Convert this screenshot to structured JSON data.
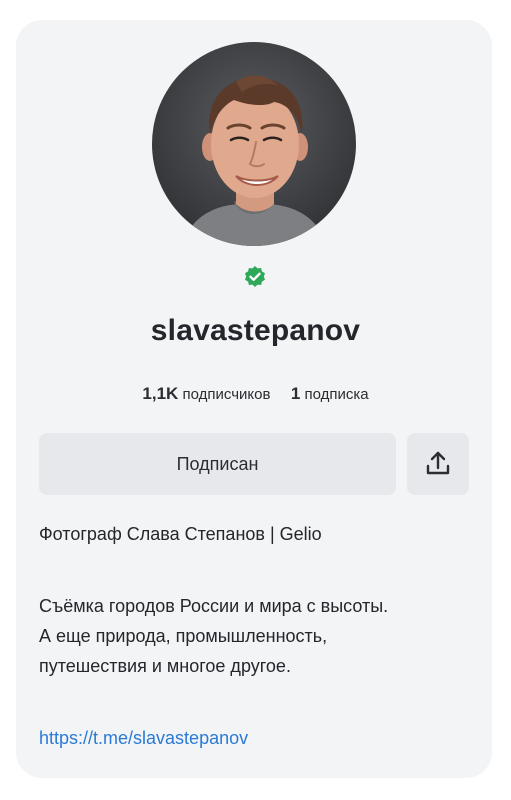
{
  "profile": {
    "username": "slavastepanov",
    "verified_icon": "verified-badge-icon",
    "stats": {
      "followers_count": "1,1K",
      "followers_label": "подписчиков",
      "following_count": "1",
      "following_label": "подписка"
    },
    "subscribe_label": "Подписан",
    "share_icon": "share-upload-icon",
    "bio_title": "Фотограф Слава Степанов | Gelio",
    "bio_lines": [
      "Съёмка городов России и мира с высоты.",
      "А еще природа, промышленность,",
      "путешествия и многое другое."
    ],
    "link": "https://t.me/slavastepanov"
  },
  "colors": {
    "card_bg": "#f3f4f6",
    "button_bg": "#e6e8ec",
    "verified_green": "#2fa85a",
    "link_blue": "#2a7ad6",
    "text": "#23262b"
  }
}
